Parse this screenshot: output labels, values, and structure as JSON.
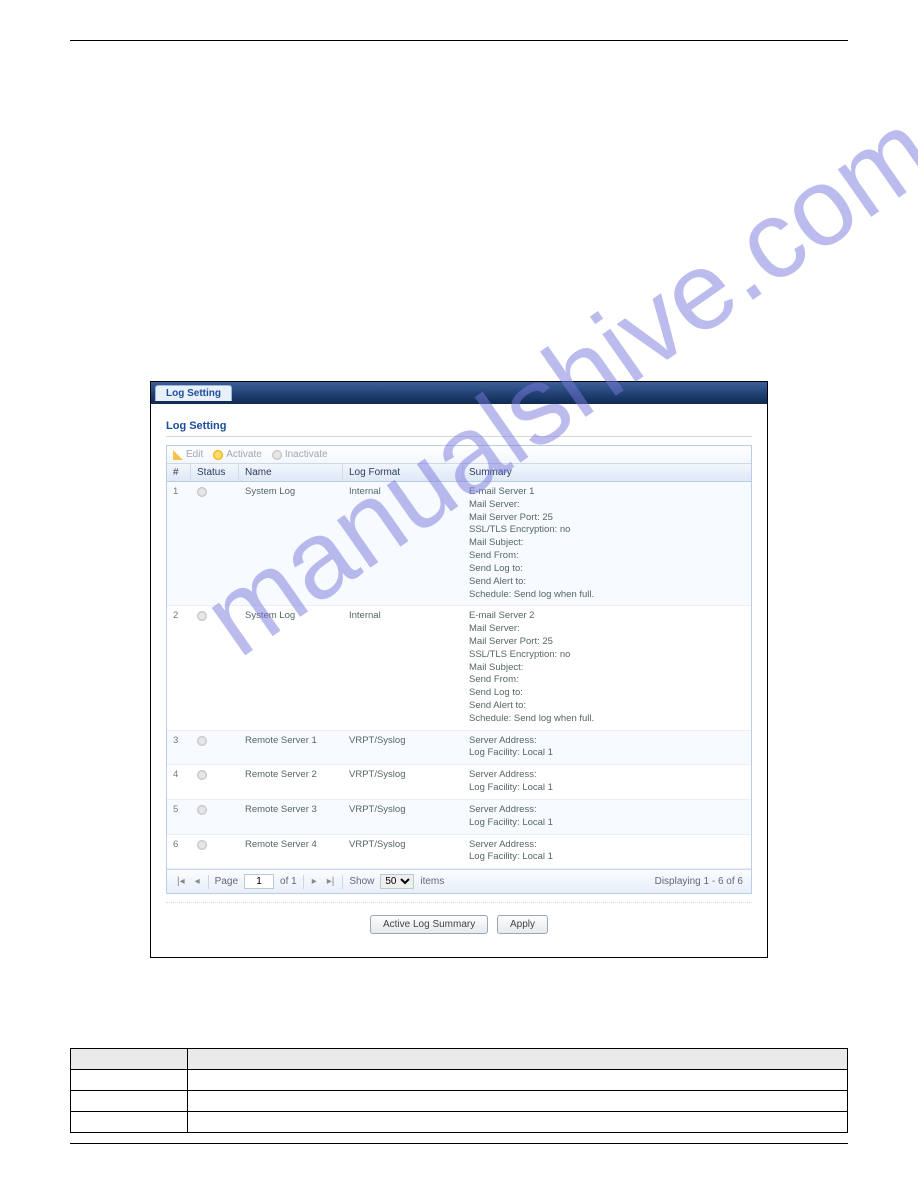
{
  "watermark": "manualshive.com",
  "tab_label": "Log Setting",
  "section_title": "Log Setting",
  "toolbar": {
    "edit": "Edit",
    "activate": "Activate",
    "inactivate": "Inactivate"
  },
  "columns": {
    "num": "#",
    "status": "Status",
    "name": "Name",
    "format": "Log Format",
    "summary": "Summary"
  },
  "rows": [
    {
      "n": "1",
      "name": "System Log",
      "format": "Internal",
      "summary": [
        "E-mail Server 1",
        "Mail Server:",
        "Mail Server Port: 25",
        "SSL/TLS Encryption: no",
        "Mail Subject:",
        "Send From:",
        "Send Log to:",
        "Send Alert to:",
        "Schedule: Send log when full."
      ]
    },
    {
      "n": "2",
      "name": "System Log",
      "format": "Internal",
      "summary": [
        "E-mail Server 2",
        "Mail Server:",
        "Mail Server Port: 25",
        "SSL/TLS Encryption: no",
        "Mail Subject:",
        "Send From:",
        "Send Log to:",
        "Send Alert to:",
        "Schedule: Send log when full."
      ]
    },
    {
      "n": "3",
      "name": "Remote Server 1",
      "format": "VRPT/Syslog",
      "summary": [
        "Server Address:",
        "Log Facility: Local 1"
      ]
    },
    {
      "n": "4",
      "name": "Remote Server 2",
      "format": "VRPT/Syslog",
      "summary": [
        "Server Address:",
        "Log Facility: Local 1"
      ]
    },
    {
      "n": "5",
      "name": "Remote Server 3",
      "format": "VRPT/Syslog",
      "summary": [
        "Server Address:",
        "Log Facility: Local 1"
      ]
    },
    {
      "n": "6",
      "name": "Remote Server 4",
      "format": "VRPT/Syslog",
      "summary": [
        "Server Address:",
        "Log Facility: Local 1"
      ]
    }
  ],
  "pager": {
    "page_label": "Page",
    "page_value": "1",
    "of_label": "of 1",
    "show_label": "Show",
    "show_value": "50",
    "items_label": "items",
    "display": "Displaying 1 - 6 of 6"
  },
  "buttons": {
    "summary": "Active Log Summary",
    "apply": "Apply"
  },
  "desc_table": {
    "h1": "",
    "h2": "",
    "rows": [
      {
        "c1": "",
        "c2": ""
      },
      {
        "c1": "",
        "c2": ""
      },
      {
        "c1": "",
        "c2": ""
      }
    ]
  }
}
